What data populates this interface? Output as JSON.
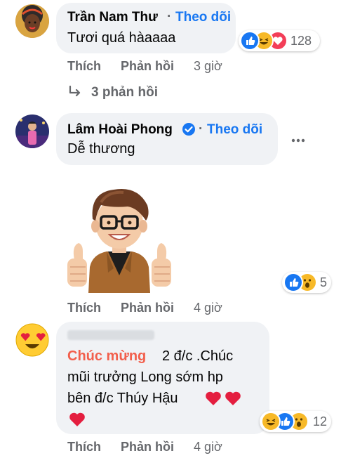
{
  "comments": [
    {
      "author": "Trần Nam Thư",
      "follow_label": "Theo dõi",
      "text": "Tươi quá hàaaaa",
      "reaction_count": "128",
      "reactions": [
        "like",
        "haha",
        "love"
      ],
      "actions": {
        "like": "Thích",
        "reply": "Phản hồi"
      },
      "time": "3 giờ",
      "replies_label": "3 phản hồi"
    },
    {
      "author": "Lâm Hoài Phong",
      "verified": true,
      "follow_label": "Theo dõi",
      "text": "Dễ thương",
      "reaction_count": "5",
      "reactions": [
        "like",
        "wow"
      ],
      "actions": {
        "like": "Thích",
        "reply": "Phản hồi"
      },
      "time": "4 giờ",
      "more_label": "•••"
    },
    {
      "author": "",
      "text_highlight": "Chúc mừng",
      "text_line1_rest": "2 đ/c .Chúc",
      "text_line2": "mũi trưởng Long sớm hp",
      "text_line3": "bên đ/c Thúy Hậu",
      "reaction_count": "12",
      "reactions": [
        "haha",
        "like",
        "wow"
      ],
      "actions": {
        "like": "Thích",
        "reply": "Phản hồi"
      },
      "time": "4 giờ"
    }
  ],
  "colors": {
    "accent": "#1877f2",
    "highlight": "#f25f4c",
    "bubble": "#f0f2f5",
    "muted": "#65676b",
    "heart": "#e41e3f"
  }
}
